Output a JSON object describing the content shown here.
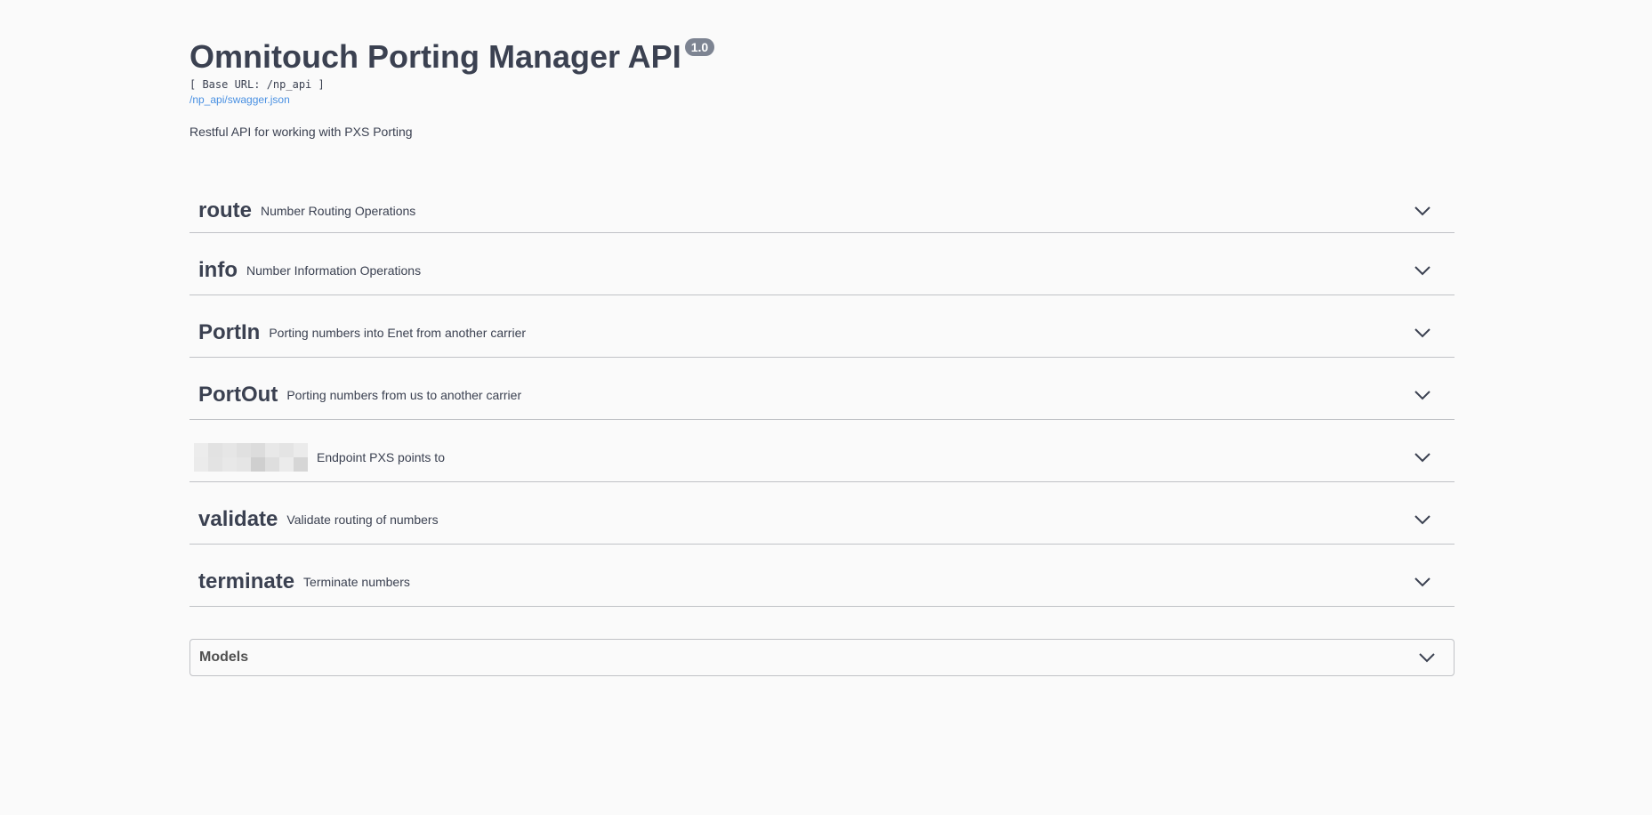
{
  "info": {
    "title": "Omnitouch Porting Manager API",
    "version": "1.0",
    "base_url": "[ Base URL: /np_api ]",
    "spec_link": "/np_api/swagger.json",
    "description": "Restful API for working with PXS Porting"
  },
  "tags": [
    {
      "name": "route",
      "description": "Number Routing Operations"
    },
    {
      "name": "info",
      "description": "Number Information Operations"
    },
    {
      "name": "PortIn",
      "description": "Porting numbers into Enet from another carrier"
    },
    {
      "name": "PortOut",
      "description": "Porting numbers from us to another carrier"
    },
    {
      "name": "",
      "description": "Endpoint PXS points to",
      "redacted": true
    },
    {
      "name": "validate",
      "description": "Validate routing of numbers"
    },
    {
      "name": "terminate",
      "description": "Terminate numbers"
    }
  ],
  "models": {
    "title": "Models"
  },
  "icons": {
    "expand": "chevron-down-icon"
  }
}
